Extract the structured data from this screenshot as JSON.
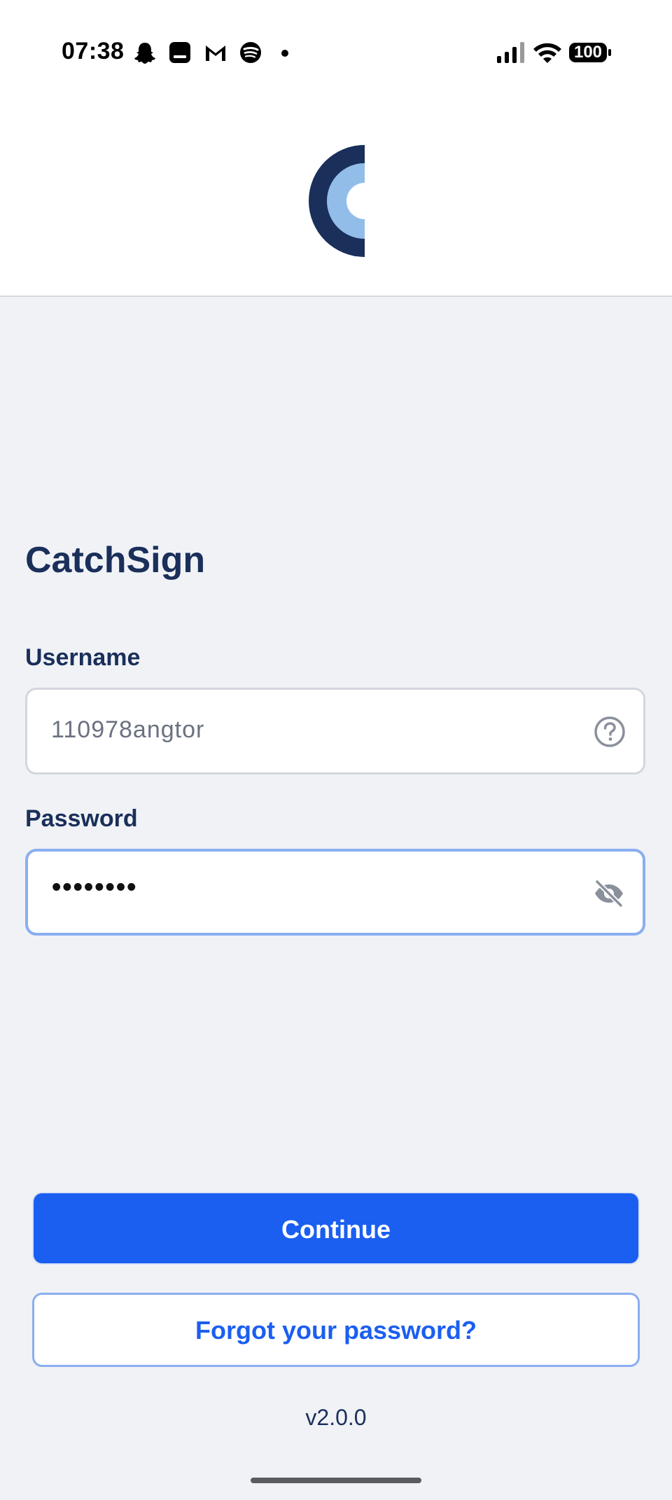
{
  "status_bar": {
    "time": "07:38",
    "notification_icons": [
      "snapchat-icon",
      "app-icon",
      "gmail-icon",
      "spotify-icon",
      "dot-icon"
    ],
    "battery": "100",
    "signal_icon": "signal-icon",
    "wifi_icon": "wifi-icon"
  },
  "header": {
    "logo_icon": "catchsign-logo-icon",
    "colors": {
      "logo_dark": "#1a2f5a",
      "logo_light": "#93bde9"
    }
  },
  "login": {
    "app_title": "CatchSign",
    "username_label": "Username",
    "username_value": "110978angtor",
    "username_help_icon": "question-circle-icon",
    "password_label": "Password",
    "password_value": "••••••••",
    "password_toggle_icon": "eye-off-icon",
    "continue_label": "Continue",
    "forgot_label": "Forgot your password?",
    "version": "v2.0.0"
  },
  "colors": {
    "primary": "#1b5ff0",
    "background": "#f0f2f6",
    "text_dark": "#1a2f5a",
    "focus_border": "#8aaef0"
  }
}
